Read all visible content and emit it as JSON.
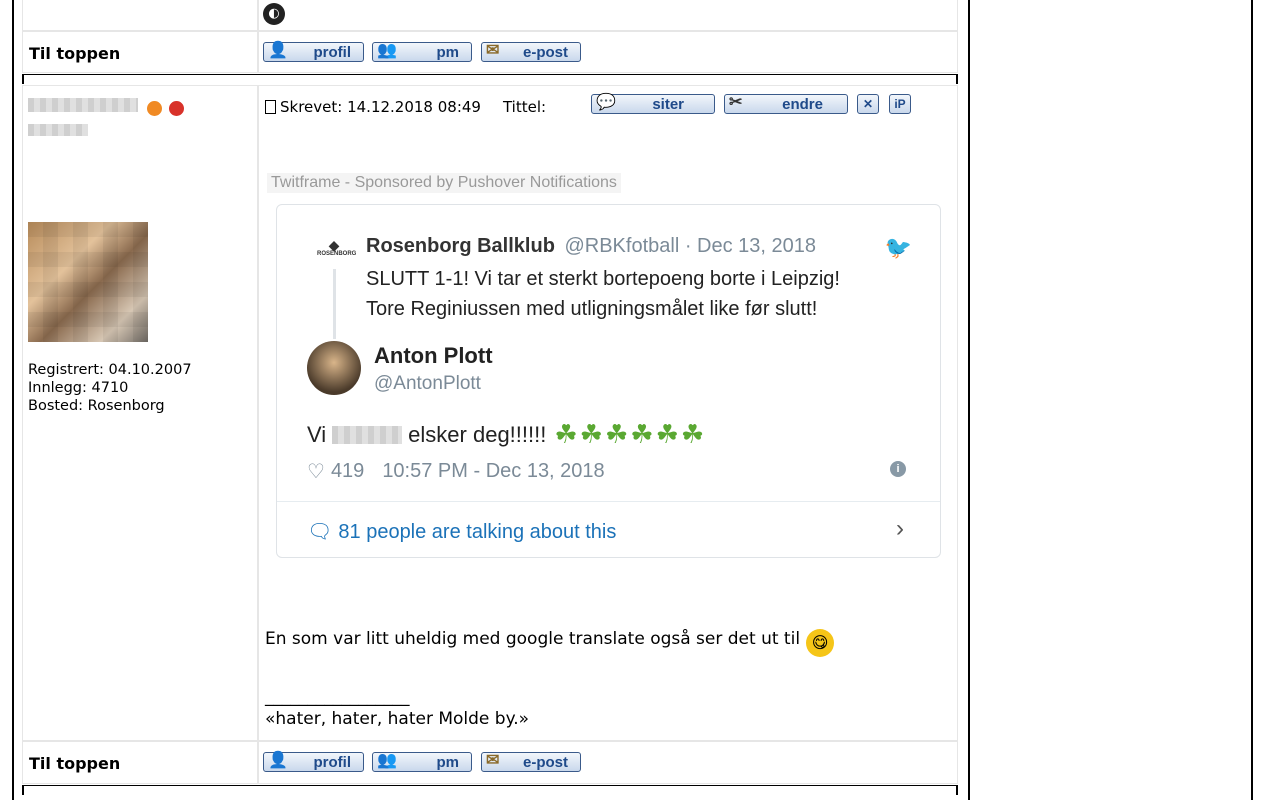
{
  "rows": {
    "to_top_label": "Til toppen",
    "buttons": {
      "profile": "profil",
      "pm": "pm",
      "email": "e-post"
    }
  },
  "post": {
    "user": {
      "registered": "Registrert: 04.10.2007",
      "posts": "Innlegg: 4710",
      "location": "Bosted: Rosenborg"
    },
    "header": {
      "written": "Skrevet: 14.12.2018 08:49",
      "title_label": "Tittel:",
      "quote_button": "siter",
      "edit_button": "endre",
      "delete_label": "✕",
      "ip_label": "iP"
    },
    "embed": {
      "caption": "Twitframe - Sponsored by Pushover Notifications",
      "quoted": {
        "name": "Rosenborg Ballklub",
        "handle_date": "@RBKfotball · Dec 13, 2018",
        "logo_text": "ROSENBORG",
        "line1": "SLUTT 1-1! Vi tar et sterkt bortepoeng borte i Leipzig!",
        "line2": "Tore Reginiussen med utligningsmålet like før slutt!"
      },
      "author": {
        "name": "Anton Plott",
        "handle": "@AntonPlott"
      },
      "text_before": "Vi",
      "text_after": "elsker deg!!!!!!",
      "clovers": "☘☘☘☘☘☘",
      "likes": "419",
      "timestamp": "10:57 PM - Dec 13, 2018",
      "talking": "81 people are talking about this"
    },
    "body": "En som var litt uheldig med google translate også ser det ut til",
    "signature_line": "_________________",
    "signature": "«hater, hater, hater Molde by.»"
  }
}
